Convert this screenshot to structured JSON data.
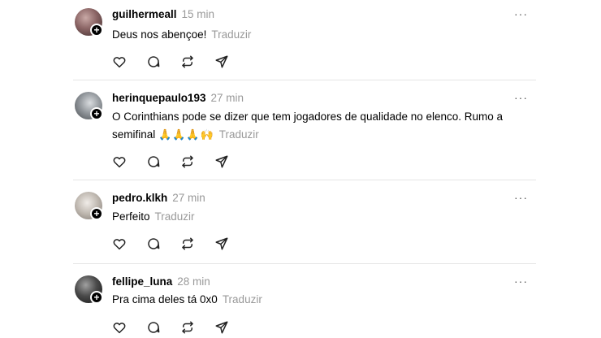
{
  "translate_label": "Traduzir",
  "more_glyph": "···",
  "posts": [
    {
      "username": "guilhermeall",
      "time": "15 min",
      "text": "Deus nos abençoe!",
      "emoji": "",
      "text_line2": "",
      "avatar_color": "#6b4f4f"
    },
    {
      "username": "herinquepaulo193",
      "time": "27 min",
      "text": "O Corinthians pode se dizer que tem jogadores de qualidade no elenco. Rumo a",
      "text_line2": "semifinal",
      "emoji": "🙏🙏🙏🙌",
      "avatar_color": "#7a7f84"
    },
    {
      "username": "pedro.klkh",
      "time": "27 min",
      "text": "Perfeito",
      "emoji": "",
      "text_line2": "",
      "avatar_color": "#b8b3ad"
    },
    {
      "username": "fellipe_luna",
      "time": "28 min",
      "text": "Pra cima deles tá 0x0",
      "emoji": "",
      "text_line2": "",
      "avatar_color": "#3a3a3a"
    }
  ]
}
